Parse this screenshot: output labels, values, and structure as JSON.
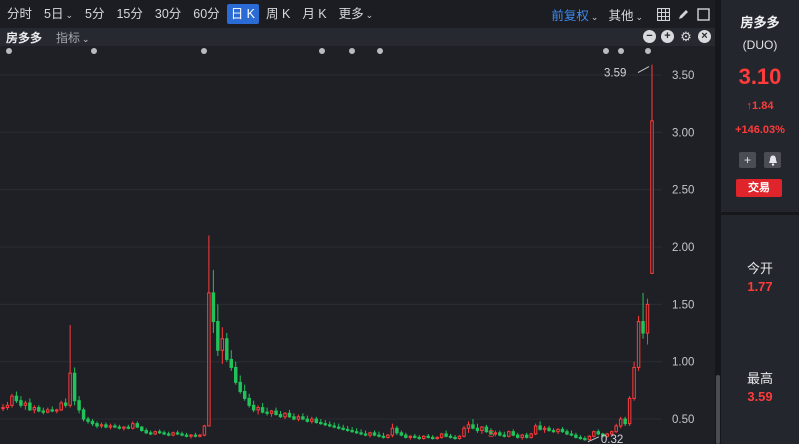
{
  "toolbar": {
    "periods": [
      "分时",
      "5日",
      "5分",
      "15分",
      "30分",
      "60分",
      "日 K",
      "周 K",
      "月 K",
      "更多"
    ],
    "active_period": "日 K",
    "adjust": "前复权",
    "other": "其他"
  },
  "subbar": {
    "name": "房多多",
    "indicator": "指标"
  },
  "side": {
    "name": "房多多",
    "code": "(DUO)",
    "price": "3.10",
    "change": "1.84",
    "change_pct": "+146.03%",
    "trade_label": "交易",
    "open_label": "今开",
    "open_value": "1.77",
    "high_label": "最高",
    "high_value": "3.59"
  },
  "colors": {
    "up": "#ff3b3b",
    "down": "#21c25a",
    "accent": "#2a6bd5",
    "link": "#3d8bf0"
  },
  "chart_data": {
    "type": "candlestick",
    "y_ticks": [
      "3.50",
      "3.00",
      "2.50",
      "2.00",
      "1.50",
      "1.00",
      "0.50"
    ],
    "ylim": [
      0.3,
      3.7
    ],
    "max_label": "3.59",
    "min_label": "0.32",
    "marker": "S",
    "candles": [
      [
        0.6,
        0.63,
        0.57,
        0.6
      ],
      [
        0.6,
        0.65,
        0.58,
        0.62
      ],
      [
        0.62,
        0.72,
        0.6,
        0.7
      ],
      [
        0.7,
        0.74,
        0.64,
        0.66
      ],
      [
        0.66,
        0.7,
        0.6,
        0.62
      ],
      [
        0.62,
        0.66,
        0.58,
        0.64
      ],
      [
        0.64,
        0.68,
        0.57,
        0.58
      ],
      [
        0.58,
        0.62,
        0.55,
        0.6
      ],
      [
        0.6,
        0.62,
        0.56,
        0.57
      ],
      [
        0.57,
        0.6,
        0.54,
        0.56
      ],
      [
        0.56,
        0.6,
        0.55,
        0.58
      ],
      [
        0.58,
        0.61,
        0.56,
        0.57
      ],
      [
        0.57,
        0.59,
        0.55,
        0.58
      ],
      [
        0.58,
        0.66,
        0.57,
        0.64
      ],
      [
        0.64,
        0.68,
        0.6,
        0.62
      ],
      [
        0.62,
        1.32,
        0.6,
        0.9
      ],
      [
        0.9,
        0.95,
        0.62,
        0.66
      ],
      [
        0.66,
        0.7,
        0.55,
        0.58
      ],
      [
        0.58,
        0.6,
        0.48,
        0.5
      ],
      [
        0.5,
        0.52,
        0.46,
        0.48
      ],
      [
        0.48,
        0.5,
        0.44,
        0.46
      ],
      [
        0.46,
        0.48,
        0.42,
        0.44
      ],
      [
        0.44,
        0.47,
        0.42,
        0.45
      ],
      [
        0.45,
        0.47,
        0.42,
        0.43
      ],
      [
        0.43,
        0.46,
        0.41,
        0.44
      ],
      [
        0.44,
        0.46,
        0.42,
        0.43
      ],
      [
        0.43,
        0.45,
        0.41,
        0.42
      ],
      [
        0.42,
        0.44,
        0.4,
        0.43
      ],
      [
        0.43,
        0.45,
        0.41,
        0.42
      ],
      [
        0.42,
        0.48,
        0.41,
        0.46
      ],
      [
        0.46,
        0.48,
        0.42,
        0.43
      ],
      [
        0.43,
        0.44,
        0.39,
        0.4
      ],
      [
        0.4,
        0.42,
        0.37,
        0.38
      ],
      [
        0.38,
        0.4,
        0.36,
        0.37
      ],
      [
        0.37,
        0.4,
        0.36,
        0.39
      ],
      [
        0.39,
        0.41,
        0.37,
        0.38
      ],
      [
        0.38,
        0.4,
        0.36,
        0.37
      ],
      [
        0.37,
        0.39,
        0.35,
        0.36
      ],
      [
        0.36,
        0.39,
        0.35,
        0.38
      ],
      [
        0.38,
        0.4,
        0.36,
        0.37
      ],
      [
        0.37,
        0.39,
        0.35,
        0.36
      ],
      [
        0.36,
        0.38,
        0.34,
        0.35
      ],
      [
        0.35,
        0.37,
        0.33,
        0.36
      ],
      [
        0.36,
        0.38,
        0.34,
        0.35
      ],
      [
        0.35,
        0.37,
        0.34,
        0.36
      ],
      [
        0.36,
        0.45,
        0.35,
        0.44
      ],
      [
        0.44,
        2.1,
        0.44,
        1.6
      ],
      [
        1.6,
        1.8,
        1.25,
        1.35
      ],
      [
        1.35,
        1.5,
        1.05,
        1.1
      ],
      [
        1.1,
        1.3,
        0.98,
        1.2
      ],
      [
        1.2,
        1.25,
        1.0,
        1.02
      ],
      [
        1.02,
        1.1,
        0.92,
        0.95
      ],
      [
        0.95,
        1.0,
        0.8,
        0.82
      ],
      [
        0.82,
        0.88,
        0.72,
        0.74
      ],
      [
        0.74,
        0.8,
        0.66,
        0.68
      ],
      [
        0.68,
        0.72,
        0.6,
        0.62
      ],
      [
        0.62,
        0.66,
        0.56,
        0.58
      ],
      [
        0.58,
        0.62,
        0.54,
        0.6
      ],
      [
        0.6,
        0.64,
        0.55,
        0.56
      ],
      [
        0.56,
        0.6,
        0.53,
        0.55
      ],
      [
        0.55,
        0.58,
        0.52,
        0.57
      ],
      [
        0.57,
        0.6,
        0.53,
        0.54
      ],
      [
        0.54,
        0.57,
        0.51,
        0.52
      ],
      [
        0.52,
        0.56,
        0.5,
        0.55
      ],
      [
        0.55,
        0.58,
        0.51,
        0.52
      ],
      [
        0.52,
        0.55,
        0.49,
        0.5
      ],
      [
        0.5,
        0.54,
        0.48,
        0.52
      ],
      [
        0.52,
        0.55,
        0.49,
        0.5
      ],
      [
        0.5,
        0.53,
        0.47,
        0.48
      ],
      [
        0.48,
        0.52,
        0.46,
        0.5
      ],
      [
        0.5,
        0.52,
        0.46,
        0.47
      ],
      [
        0.47,
        0.5,
        0.45,
        0.46
      ],
      [
        0.46,
        0.49,
        0.44,
        0.45
      ],
      [
        0.45,
        0.48,
        0.43,
        0.44
      ],
      [
        0.44,
        0.47,
        0.42,
        0.43
      ],
      [
        0.43,
        0.46,
        0.41,
        0.42
      ],
      [
        0.42,
        0.45,
        0.4,
        0.41
      ],
      [
        0.41,
        0.44,
        0.39,
        0.4
      ],
      [
        0.4,
        0.43,
        0.38,
        0.39
      ],
      [
        0.39,
        0.42,
        0.37,
        0.38
      ],
      [
        0.38,
        0.41,
        0.36,
        0.37
      ],
      [
        0.37,
        0.4,
        0.35,
        0.36
      ],
      [
        0.36,
        0.39,
        0.34,
        0.38
      ],
      [
        0.38,
        0.4,
        0.35,
        0.36
      ],
      [
        0.36,
        0.39,
        0.34,
        0.35
      ],
      [
        0.35,
        0.38,
        0.33,
        0.34
      ],
      [
        0.34,
        0.37,
        0.33,
        0.36
      ],
      [
        0.36,
        0.46,
        0.34,
        0.42
      ],
      [
        0.42,
        0.44,
        0.36,
        0.38
      ],
      [
        0.38,
        0.4,
        0.35,
        0.36
      ],
      [
        0.36,
        0.38,
        0.33,
        0.34
      ],
      [
        0.34,
        0.36,
        0.32,
        0.35
      ],
      [
        0.35,
        0.37,
        0.33,
        0.34
      ],
      [
        0.34,
        0.36,
        0.32,
        0.33
      ],
      [
        0.33,
        0.36,
        0.32,
        0.35
      ],
      [
        0.35,
        0.37,
        0.33,
        0.34
      ],
      [
        0.34,
        0.36,
        0.32,
        0.33
      ],
      [
        0.33,
        0.35,
        0.32,
        0.34
      ],
      [
        0.34,
        0.38,
        0.33,
        0.37
      ],
      [
        0.37,
        0.4,
        0.34,
        0.35
      ],
      [
        0.35,
        0.37,
        0.33,
        0.34
      ],
      [
        0.34,
        0.36,
        0.32,
        0.33
      ],
      [
        0.33,
        0.36,
        0.32,
        0.35
      ],
      [
        0.35,
        0.44,
        0.34,
        0.42
      ],
      [
        0.42,
        0.48,
        0.38,
        0.45
      ],
      [
        0.45,
        0.5,
        0.41,
        0.42
      ],
      [
        0.42,
        0.46,
        0.38,
        0.4
      ],
      [
        0.4,
        0.44,
        0.37,
        0.43
      ],
      [
        0.43,
        0.45,
        0.38,
        0.39
      ],
      [
        0.39,
        0.42,
        0.36,
        0.37
      ],
      [
        0.37,
        0.4,
        0.35,
        0.38
      ],
      [
        0.38,
        0.4,
        0.35,
        0.36
      ],
      [
        0.36,
        0.39,
        0.34,
        0.35
      ],
      [
        0.35,
        0.4,
        0.34,
        0.39
      ],
      [
        0.39,
        0.41,
        0.35,
        0.36
      ],
      [
        0.36,
        0.38,
        0.33,
        0.34
      ],
      [
        0.34,
        0.37,
        0.32,
        0.36
      ],
      [
        0.36,
        0.38,
        0.33,
        0.34
      ],
      [
        0.34,
        0.38,
        0.33,
        0.37
      ],
      [
        0.37,
        0.46,
        0.36,
        0.44
      ],
      [
        0.44,
        0.48,
        0.4,
        0.41
      ],
      [
        0.41,
        0.44,
        0.38,
        0.42
      ],
      [
        0.42,
        0.44,
        0.39,
        0.4
      ],
      [
        0.4,
        0.42,
        0.38,
        0.39
      ],
      [
        0.39,
        0.42,
        0.37,
        0.41
      ],
      [
        0.41,
        0.43,
        0.38,
        0.39
      ],
      [
        0.39,
        0.41,
        0.36,
        0.37
      ],
      [
        0.37,
        0.4,
        0.35,
        0.36
      ],
      [
        0.36,
        0.38,
        0.33,
        0.34
      ],
      [
        0.34,
        0.36,
        0.32,
        0.33
      ],
      [
        0.33,
        0.35,
        0.31,
        0.32
      ],
      [
        0.32,
        0.36,
        0.32,
        0.35
      ],
      [
        0.35,
        0.4,
        0.34,
        0.39
      ],
      [
        0.39,
        0.41,
        0.36,
        0.37
      ],
      [
        0.37,
        0.38,
        0.34,
        0.35
      ],
      [
        0.35,
        0.38,
        0.34,
        0.37
      ],
      [
        0.37,
        0.4,
        0.36,
        0.39
      ],
      [
        0.39,
        0.46,
        0.38,
        0.44
      ],
      [
        0.44,
        0.52,
        0.42,
        0.5
      ],
      [
        0.5,
        0.52,
        0.44,
        0.46
      ],
      [
        0.46,
        0.7,
        0.44,
        0.68
      ],
      [
        0.68,
        1.0,
        0.66,
        0.95
      ],
      [
        0.95,
        1.4,
        0.92,
        1.35
      ],
      [
        1.35,
        1.6,
        1.2,
        1.25
      ],
      [
        1.25,
        1.55,
        1.15,
        1.5
      ],
      [
        1.77,
        3.59,
        1.77,
        3.1
      ]
    ]
  }
}
